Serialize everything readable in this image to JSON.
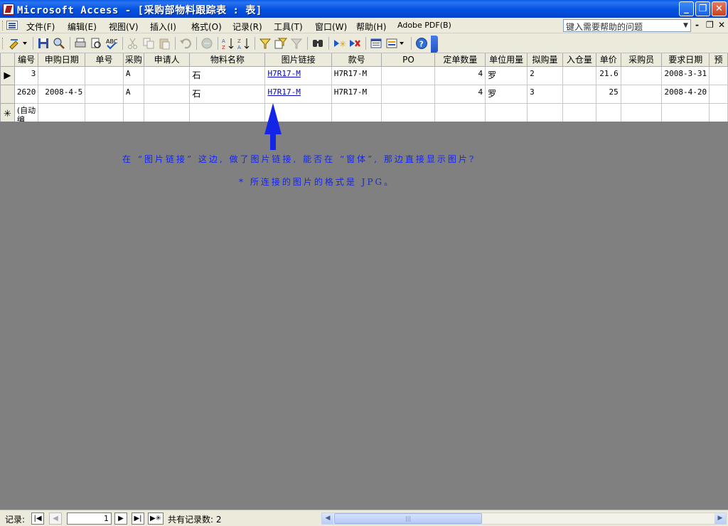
{
  "window": {
    "title": "Microsoft Access - [采购部物料跟踪表 : 表]",
    "buttons": {
      "minimize": "_",
      "restore": "❐",
      "close": "✕"
    }
  },
  "menubar": {
    "items": [
      "文件(F)",
      "编辑(E)",
      "视图(V)",
      "插入(I)",
      "格式(O)",
      "记录(R)",
      "工具(T)",
      "窗口(W)",
      "帮助(H)",
      "Adobe PDF(B)"
    ],
    "help_placeholder": "键入需要帮助的问题",
    "mdi_controls": [
      "-",
      "❐",
      "✕"
    ]
  },
  "toolbar": {
    "icons": [
      "design-view-icon",
      "save-icon",
      "search-icon",
      "print-icon",
      "print-preview-icon",
      "spelling-icon",
      "cut-icon",
      "copy-icon",
      "paste-icon",
      "undo-icon",
      "hyperlink-icon",
      "sort-ascending-icon",
      "sort-descending-icon",
      "filter-by-selection-icon",
      "filter-by-form-icon",
      "apply-filter-icon",
      "find-icon",
      "new-record-icon",
      "delete-record-icon",
      "database-window-icon",
      "new-object-icon",
      "help-icon"
    ]
  },
  "datasheet": {
    "columns": [
      "编号",
      "申购日期",
      "单号",
      "采购",
      "申请人",
      "物料名称",
      "图片链接",
      "款号",
      "PO",
      "定单数量",
      "单位用量",
      "拟购量",
      "入仓量",
      "单价",
      "采购员",
      "要求日期",
      "预"
    ],
    "rows": [
      {
        "selector": "▶",
        "cells": [
          "3",
          "",
          "",
          "A",
          "",
          "石",
          "H7R17-M",
          "H7R17-M",
          "",
          "4",
          "罗",
          "2",
          "",
          "21.6",
          "",
          "2008-3-31",
          ""
        ]
      },
      {
        "selector": "",
        "cells": [
          "2620",
          "2008-4-5",
          "",
          "A",
          "",
          "石",
          "H7R17-M",
          "H7R17-M",
          "",
          "4",
          "罗",
          "3",
          "",
          "25",
          "",
          "2008-4-20",
          ""
        ]
      }
    ],
    "new_row": {
      "selector": "✳",
      "first_cell": "(自动编"
    }
  },
  "annotations": {
    "line1": "在 “图片链接” 这边, 做了图片链接, 能否在 “窗体”, 那边直接显示图片?",
    "line2": "* 所连接的图片的格式是 JPG。",
    "color": "#1525e8"
  },
  "statusbar": {
    "record_label": "记录:",
    "current_record": "1",
    "total_label": "共有记录数: 2",
    "nav_first": "|◀",
    "nav_prev": "◀",
    "nav_next": "▶",
    "nav_last": "▶|",
    "nav_new": "▶✳"
  }
}
